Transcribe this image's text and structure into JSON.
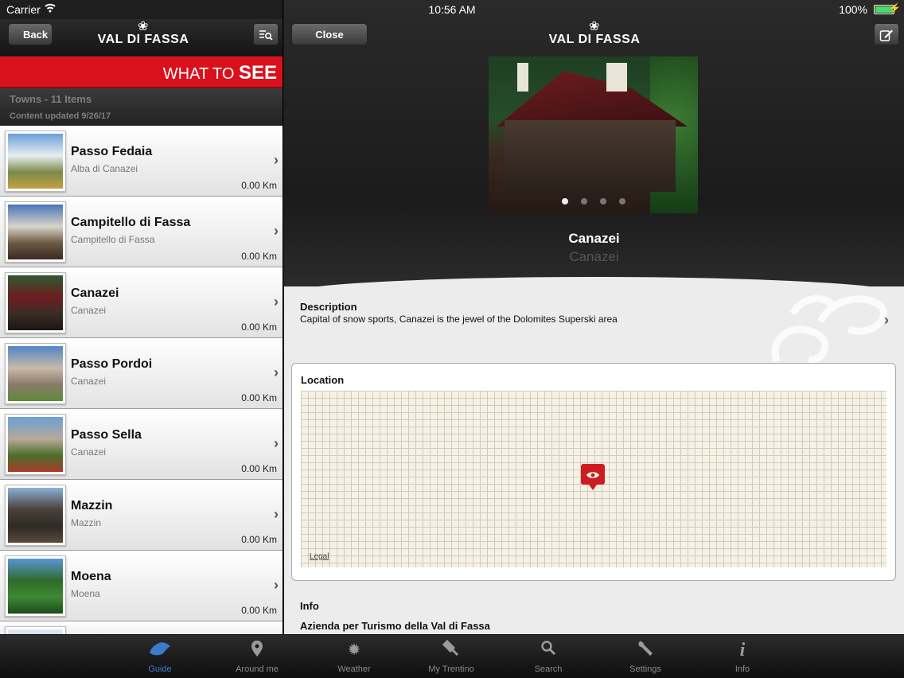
{
  "status_bar": {
    "carrier": "Carrier",
    "time": "10:56 AM",
    "battery": "100%"
  },
  "left_nav": {
    "back_label": "Back",
    "logo_text": "VAL DI FASSA"
  },
  "banner": {
    "prefix": "WHAT TO ",
    "emph": "SEE"
  },
  "list_header": {
    "count": "Towns - 11 Items",
    "updated": "Content updated 9/26/17"
  },
  "items": [
    {
      "title": "Passo Fedaia",
      "subtitle": "Alba di Canazei",
      "distance": "0.00 Km",
      "thumb_colors": [
        "#6a9fd8",
        "#e8eef2",
        "#7a8a4a",
        "#c4a040"
      ]
    },
    {
      "title": "Campitello di Fassa",
      "subtitle": "Campitello di Fassa",
      "distance": "0.00 Km",
      "thumb_colors": [
        "#4a74b8",
        "#d8d4c8",
        "#6d5a44",
        "#3a2a22"
      ]
    },
    {
      "title": "Canazei",
      "subtitle": "Canazei",
      "distance": "0.00 Km",
      "thumb_colors": [
        "#2e5a30",
        "#6e1d20",
        "#3a2d26",
        "#1c1614"
      ]
    },
    {
      "title": "Passo Pordoi",
      "subtitle": "Canazei",
      "distance": "0.00 Km",
      "thumb_colors": [
        "#4f86c8",
        "#c9b9a8",
        "#8a7a6a",
        "#5f8a3a"
      ]
    },
    {
      "title": "Passo Sella",
      "subtitle": "Canazei",
      "distance": "0.00 Km",
      "thumb_colors": [
        "#6ba0d6",
        "#b8a898",
        "#4d6e2a",
        "#a83a2a"
      ]
    },
    {
      "title": "Mazzin",
      "subtitle": "Mazzin",
      "distance": "0.00 Km",
      "thumb_colors": [
        "#8ab0d8",
        "#4a4038",
        "#2f2a26",
        "#5a4a3a"
      ]
    },
    {
      "title": "Moena",
      "subtitle": "Moena",
      "distance": "0.00 Km",
      "thumb_colors": [
        "#5a96d8",
        "#2f6a2a",
        "#3d8a34",
        "#1e4a1c"
      ]
    }
  ],
  "detail": {
    "close_label": "Close",
    "logo_text": "VAL DI FASSA",
    "name": "Canazei",
    "subname": "Canazei",
    "description_label": "Description",
    "description_text": "Capital of snow sports, Canazei is the jewel of the Dolomites Superski area",
    "location_label": "Location",
    "map_legal": "Legal",
    "info_label": "Info",
    "info_org": "Azienda per Turismo della Val di Fassa"
  },
  "tabs": [
    {
      "label": "Guide",
      "icon": "dolomites-icon",
      "glyph": "",
      "active": true
    },
    {
      "label": "Around me",
      "icon": "location-pin-icon",
      "glyph": "",
      "active": false
    },
    {
      "label": "Weather",
      "icon": "sun-icon",
      "glyph": "✹",
      "active": false
    },
    {
      "label": "My Trentino",
      "icon": "pin-map-icon",
      "glyph": "",
      "active": false
    },
    {
      "label": "Search",
      "icon": "search-icon",
      "glyph": "",
      "active": false
    },
    {
      "label": "Settings",
      "icon": "wrench-icon",
      "glyph": "",
      "active": false
    },
    {
      "label": "Info",
      "icon": "info-icon",
      "glyph": "i",
      "active": false
    }
  ],
  "colors": {
    "accent_red": "#d8111d",
    "tab_active": "#3a7cc8",
    "map_pin": "#cc1c22"
  }
}
